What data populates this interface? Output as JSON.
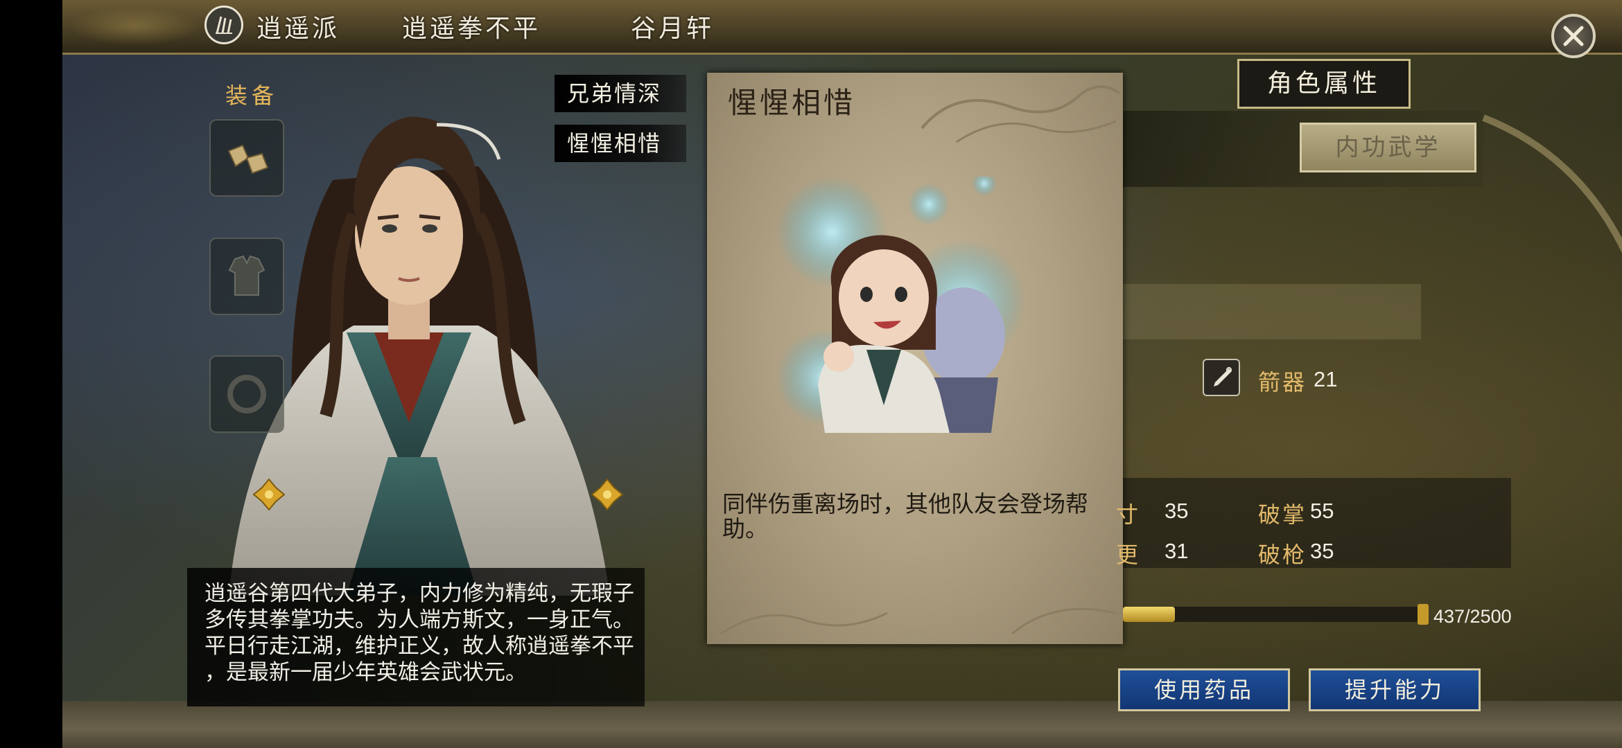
{
  "header": {
    "sect": "逍遥派",
    "nickname": "逍遥拳不平",
    "name": "谷月轩"
  },
  "equipment": {
    "label": "装备"
  },
  "tags": [
    "兄弟情深",
    "惺惺相惜"
  ],
  "description": [
    "逍遥谷第四代大弟子，内力修为精纯，无瑕子",
    "多传其拳掌功夫。为人端方斯文，一身正气。",
    "平日行走江湖，维护正义，故人称逍遥拳不平",
    "，是最新一届少年英雄会武状元。"
  ],
  "card": {
    "title": "惺惺相惜",
    "text": "同伴伤重离场时，其他队友会登场帮助。"
  },
  "tabs": {
    "attributes": "角色属性",
    "neigong": "内功武学"
  },
  "stats": {
    "hidden_weapon_label": "箭器",
    "hidden_weapon_value": "21",
    "row1_left_label": "寸",
    "row1_left_value": "35",
    "row1_right_label": "破掌",
    "row1_right_value": "55",
    "row2_left_label": "更",
    "row2_left_value": "31",
    "row2_right_label": "破枪",
    "row2_right_value": "35"
  },
  "experience": {
    "text": "437/2500",
    "fraction": 0.1748
  },
  "buttons": {
    "use_medicine": "使用药品",
    "upgrade": "提升能力"
  },
  "colors": {
    "accent_gold": "#e3ba6b",
    "button_blue": "#1f4f98"
  }
}
